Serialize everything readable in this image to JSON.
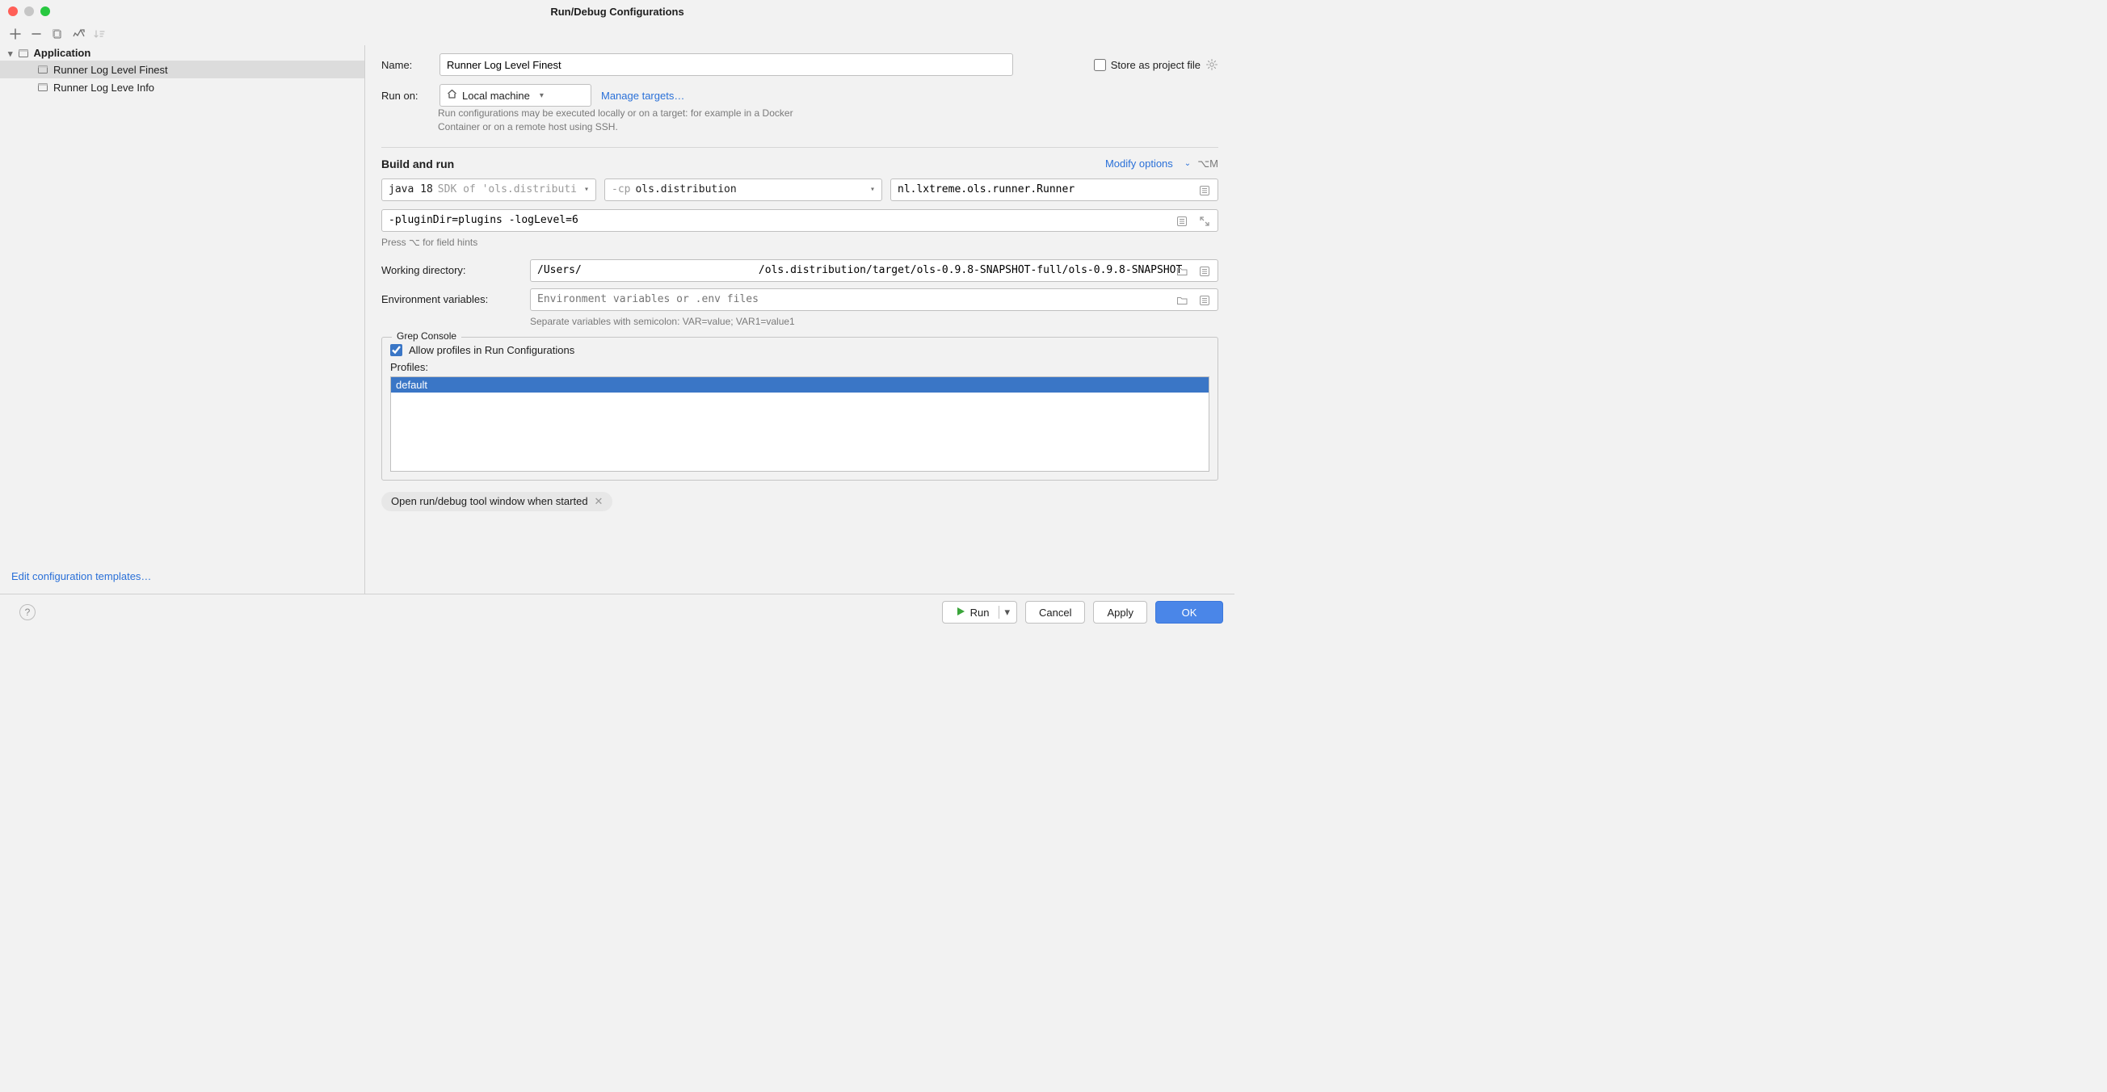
{
  "title": "Run/Debug Configurations",
  "toolbar": {
    "add": "+",
    "remove": "−",
    "copy": "copy",
    "save": "save",
    "sort": "sort"
  },
  "sidebar": {
    "group": "Application",
    "items": [
      {
        "label": "Runner Log Level Finest",
        "selected": true
      },
      {
        "label": "Runner Log Leve Info",
        "selected": false
      }
    ],
    "edit_templates": "Edit configuration templates…"
  },
  "form": {
    "name_label": "Name:",
    "name_value": "Runner Log Level Finest",
    "store_label": "Store as project file",
    "run_on_label": "Run on:",
    "run_on_value": "Local machine",
    "manage_targets": "Manage targets…",
    "run_on_help": "Run configurations may be executed locally or on a target: for example in a Docker Container or on a remote host using SSH.",
    "section_build": "Build and run",
    "modify_options": "Modify options",
    "modify_shortcut": "⌥M",
    "sdk_prefix": "java 18",
    "sdk_suffix": "SDK of 'ols.distributi",
    "cp_prefix": "-cp",
    "cp_value": "ols.distribution",
    "main_class": "nl.lxtreme.ols.runner.Runner",
    "program_args": "-pluginDir=plugins -logLevel=6",
    "field_hints": "Press ⌥ for field hints",
    "wd_label": "Working directory:",
    "wd_value": "/Users/                            /ols.distribution/target/ols-0.9.8-SNAPSHOT-full/ols-0.9.8-SNAPSHOT",
    "env_label": "Environment variables:",
    "env_placeholder": "Environment variables or .env files",
    "env_hint": "Separate variables with semicolon: VAR=value; VAR1=value1",
    "grep_legend": "Grep Console",
    "grep_checkbox_label": "Allow profiles in Run Configurations",
    "grep_checked": true,
    "profiles_label": "Profiles:",
    "profiles": [
      {
        "label": "default",
        "selected": true
      }
    ],
    "chip": "Open run/debug tool window when started"
  },
  "footer": {
    "run": "Run",
    "cancel": "Cancel",
    "apply": "Apply",
    "ok": "OK"
  }
}
